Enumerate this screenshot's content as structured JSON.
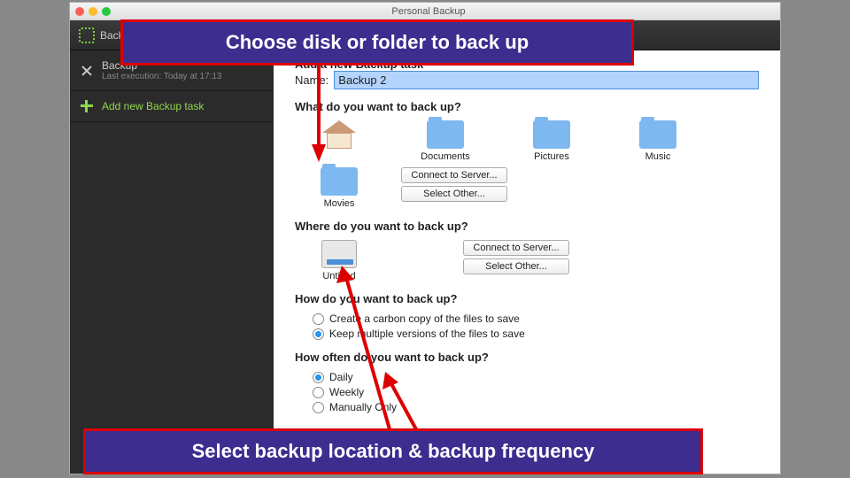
{
  "window": {
    "title": "Personal Backup"
  },
  "toolbar": {
    "tab1": "Back..."
  },
  "sidebar": {
    "backup_title": "Backup",
    "backup_sub": "Last execution: Today at 17:13",
    "add_label": "Add new Backup task"
  },
  "content": {
    "header": "Add a new Backup task",
    "name_label": "Name:",
    "name_value": "Backup 2",
    "what_header": "What do you want to back up?",
    "icons": {
      "home": "",
      "documents": "Documents",
      "pictures": "Pictures",
      "music": "Music",
      "movies": "Movies"
    },
    "connect_btn": "Connect to Server...",
    "select_btn": "Select Other...",
    "where_header": "Where do you want to back up?",
    "dest_label": "Untitled",
    "how_header": "How do you want to back up?",
    "how_opt1": "Create a carbon copy of the files to save",
    "how_opt2": "Keep multiple versions of the files to save",
    "freq_header": "How often do you want to back up?",
    "freq_daily": "Daily",
    "freq_weekly": "Weekly",
    "freq_manual": "Manually Only"
  },
  "annotations": {
    "callout1": "Choose disk or folder to back up",
    "callout2": "Select backup location & backup frequency"
  }
}
